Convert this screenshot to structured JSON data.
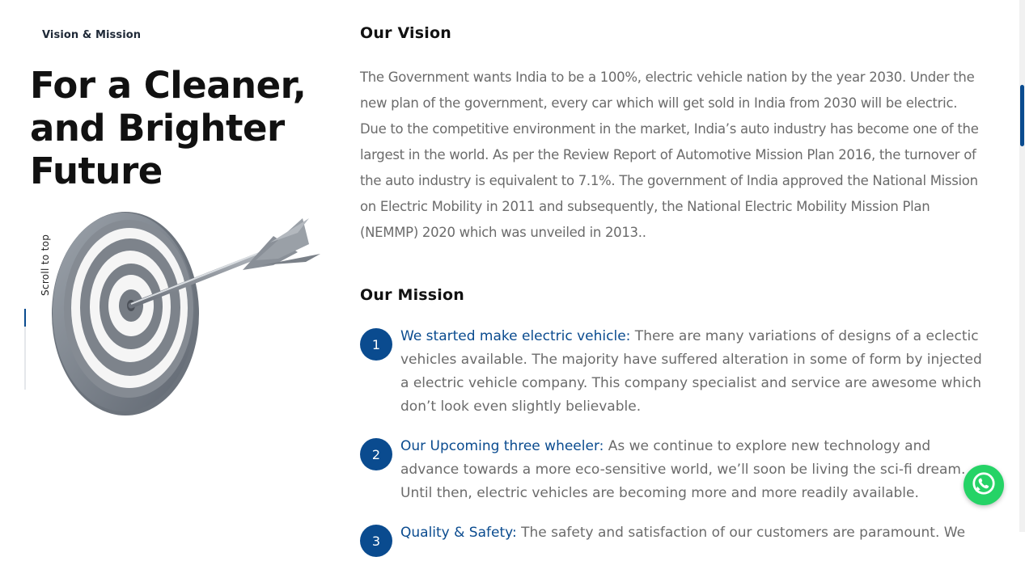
{
  "hero": {
    "eyebrow": "Vision & Mission",
    "title": "For a Cleaner, and Brighter Future",
    "scroll_top_label": "Scroll to top",
    "scroll_progress": 0.5,
    "image_icon": "dartboard-arrow-image"
  },
  "vision": {
    "title": "Our Vision",
    "text": "The Government wants India to be a 100%, electric vehicle nation by the year 2030. Under the new plan of the government, every car which will get sold in India from 2030 will be electric. Due to the competitive environment in the market, India’s auto industry has become one of the largest in the world. As per the Review Report of Automotive Mission Plan 2016, the turnover of the auto industry is equivalent to 7.1%. The government of India approved the National Mission on Electric Mobility in 2011 and subsequently, the National Electric Mobility Mission Plan (NEMMP) 2020 which was unveiled in 2013.."
  },
  "mission": {
    "title": "Our Mission",
    "items": [
      {
        "number": "1",
        "lead": "We started make electric vehicle:",
        "text": " There are many variations of designs of a eclectic vehicles available. The majority have suffered alteration in some of form by injected a electric vehicle company. This company specialist and service are awesome which don’t look even slightly believable."
      },
      {
        "number": "2",
        "lead": "Our Upcoming three wheeler:",
        "text": " As we continue to explore new technology and advance towards a more eco-sensitive world, we’ll soon be living the sci-fi dream. Until then, electric vehicles are becoming more and more readily available."
      },
      {
        "number": "3",
        "lead": "Quality & Safety:",
        "text": " The safety and satisfaction of our customers are paramount. We"
      }
    ]
  },
  "floating": {
    "whatsapp_icon": "whatsapp-icon"
  },
  "colors": {
    "accent": "#0a4b8f",
    "whatsapp": "#25d366",
    "body_text": "#6b6b6b",
    "heading": "#111111"
  },
  "page_scroll_position": 0.18
}
